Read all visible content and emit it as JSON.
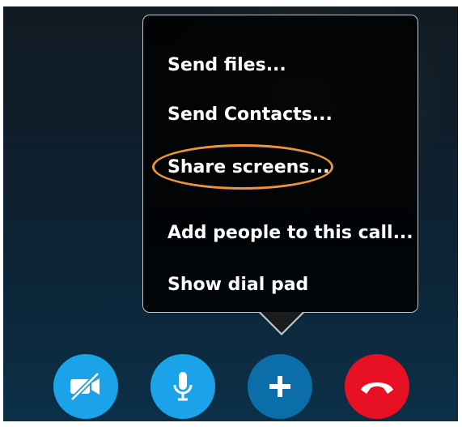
{
  "menu": {
    "items": [
      {
        "label": "Send files..."
      },
      {
        "label": "Send Contacts..."
      },
      {
        "label": "Share screens...",
        "highlighted": true
      },
      {
        "label": "Add people to this call..."
      },
      {
        "label": "Show dial pad"
      }
    ]
  },
  "controls": [
    {
      "name": "video-off-button",
      "icon": "video-off-icon",
      "color": "#1aa3e8"
    },
    {
      "name": "microphone-button",
      "icon": "microphone-icon",
      "color": "#1aa3e8"
    },
    {
      "name": "add-button",
      "icon": "plus-icon",
      "color": "#0b6ea8"
    },
    {
      "name": "end-call-button",
      "icon": "hang-up-icon",
      "color": "#e81123"
    }
  ],
  "colors": {
    "highlight_ring": "#f0943a",
    "menu_border": "#bfc6cc",
    "menu_background": "#000000"
  }
}
